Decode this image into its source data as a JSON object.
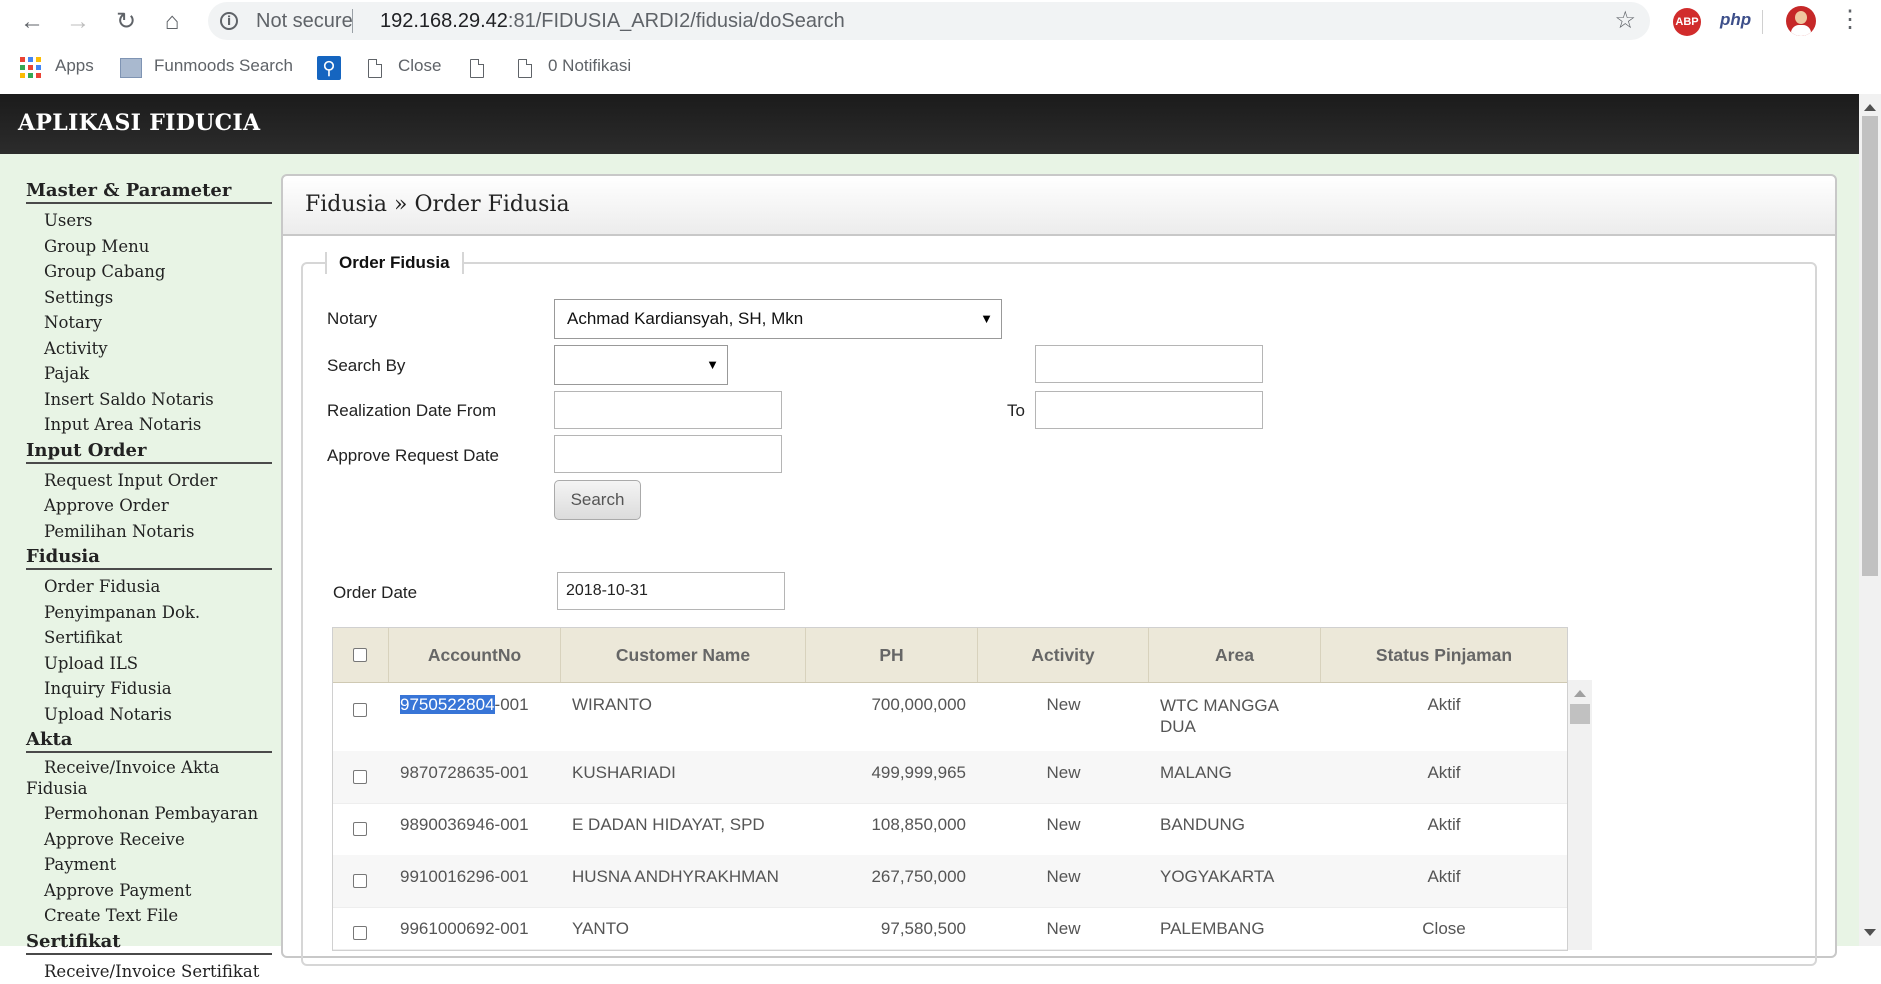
{
  "browser": {
    "not_secure": "Not secure",
    "url_host": "192.168.29.42",
    "url_rest": ":81/FIDUSIA_ARDI2/fidusia/doSearch",
    "ext_abp": "ABP",
    "ext_php": "php",
    "bookmarks": {
      "apps": "Apps",
      "funmoods": "Funmoods Search",
      "close": "Close",
      "notifikasi": "0 Notifikasi"
    }
  },
  "app": {
    "title": "APLIKASI FIDUCIA"
  },
  "sidebar": {
    "sections": [
      {
        "title": "Master & Parameter",
        "items": [
          "Users",
          "Group Menu",
          "Group Cabang",
          "Settings",
          "Notary",
          "Activity",
          "Pajak",
          "Insert Saldo Notaris",
          "Input Area Notaris"
        ]
      },
      {
        "title": "Input Order",
        "items": [
          "Request Input Order",
          "Approve Order",
          "Pemilihan Notaris"
        ]
      },
      {
        "title": "Fidusia",
        "items": [
          "Order Fidusia",
          "Penyimpanan Dok. Sertifikat",
          "Upload ILS",
          "Inquiry Fidusia",
          "Upload Notaris"
        ]
      },
      {
        "title": "Akta",
        "items": [
          "Receive/Invoice Akta Fidusia",
          "Permohonan Pembayaran",
          "Approve Receive",
          "Payment",
          "Approve Payment",
          "Create Text File"
        ]
      },
      {
        "title": "Sertifikat",
        "items": [
          "Receive/Invoice Sertifikat"
        ]
      }
    ]
  },
  "panel": {
    "breadcrumb": "Fidusia » Order Fidusia",
    "legend": "Order Fidusia"
  },
  "form": {
    "notary_label": "Notary",
    "notary_value": "Achmad Kardiansyah, SH, Mkn",
    "searchby_label": "Search By",
    "searchby_value": "",
    "search_value": "",
    "realization_label": "Realization Date From",
    "to_label": "To",
    "date_from": "",
    "date_to": "",
    "approve_label": "Approve Request Date",
    "approve_value": "",
    "search_button": "Search",
    "order_date_label": "Order Date",
    "order_date_value": "2018-10-31"
  },
  "table": {
    "headers": [
      "AccountNo",
      "Customer Name",
      "PH",
      "Activity",
      "Area",
      "Status Pinjaman"
    ],
    "rows": [
      {
        "acc_sel": "9750522804",
        "acc_rest": "-001",
        "name": "WIRANTO",
        "ph": "700,000,000",
        "activity": "New",
        "area": "WTC MANGGA DUA",
        "status": "Aktif"
      },
      {
        "acc_sel": "",
        "acc_rest": "9870728635-001",
        "name": "KUSHARIADI",
        "ph": "499,999,965",
        "activity": "New",
        "area": "MALANG",
        "status": "Aktif"
      },
      {
        "acc_sel": "",
        "acc_rest": "9890036946-001",
        "name": "E DADAN HIDAYAT, SPD",
        "ph": "108,850,000",
        "activity": "New",
        "area": "BANDUNG",
        "status": "Aktif"
      },
      {
        "acc_sel": "",
        "acc_rest": "9910016296-001",
        "name": "HUSNA ANDHYRAKHMAN",
        "ph": "267,750,000",
        "activity": "New",
        "area": "YOGYAKARTA",
        "status": "Aktif"
      },
      {
        "acc_sel": "",
        "acc_rest": "9961000692-001",
        "name": "YANTO",
        "ph": "97,580,500",
        "activity": "New",
        "area": "PALEMBANG",
        "status": "Close"
      }
    ]
  },
  "colors": {
    "header_bg": "#222222",
    "sidebar_bg": "#e8f4e5",
    "table_head": "#ece8d9",
    "selection": "#3875d7"
  }
}
